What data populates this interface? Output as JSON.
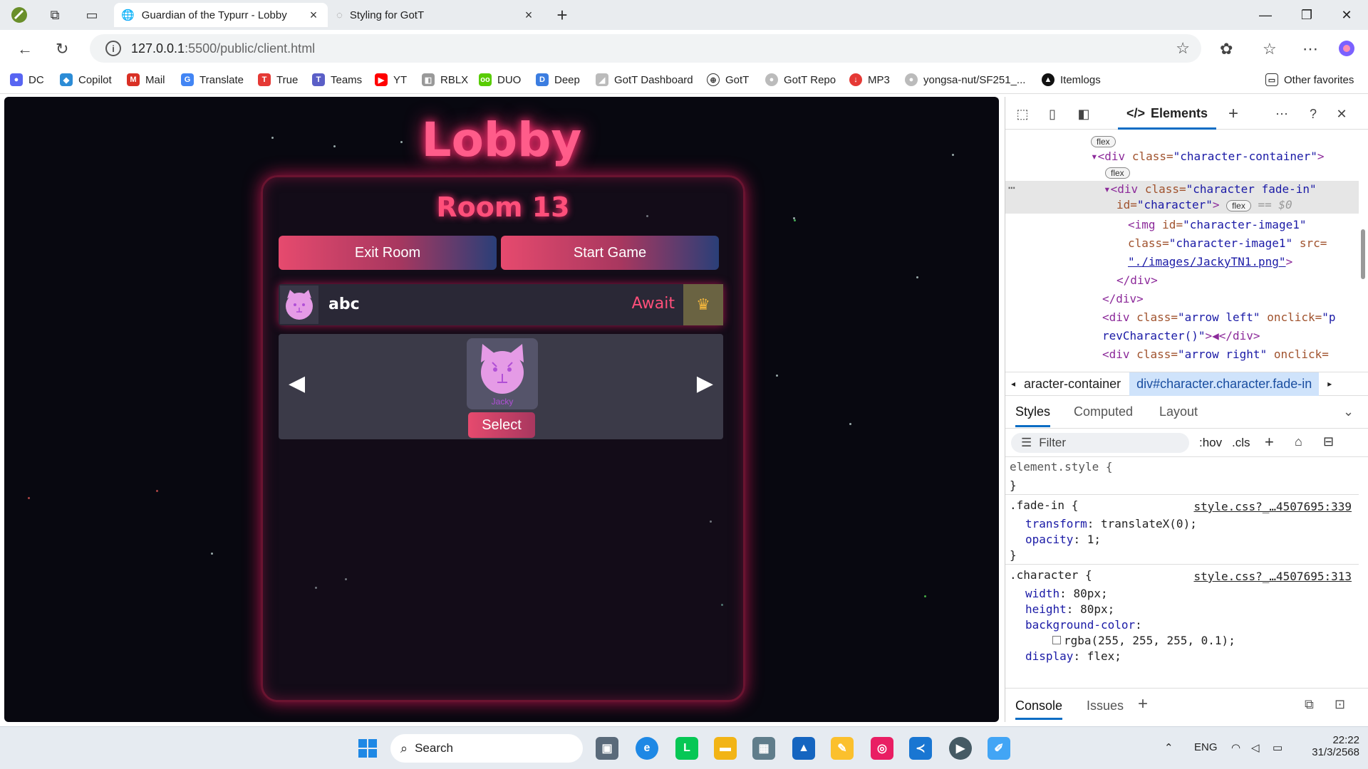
{
  "browser": {
    "tabs": [
      {
        "title": "Guardian of the Typurr - Lobby",
        "active": true
      },
      {
        "title": "Styling for GotT",
        "active": false
      }
    ],
    "url_host": "127.0.0.1",
    "url_path": ":5500/public/client.html",
    "bookmarks": [
      {
        "label": "DC",
        "color": "#5865f2"
      },
      {
        "label": "Copilot",
        "color": "#2c8cd6"
      },
      {
        "label": "Mail",
        "color": "#d93025"
      },
      {
        "label": "Translate",
        "color": "#4285f4"
      },
      {
        "label": "True",
        "color": "#e53935"
      },
      {
        "label": "Teams",
        "color": "#5b5fc7"
      },
      {
        "label": "YT",
        "color": "#ff0000"
      },
      {
        "label": "RBLX",
        "color": "#777777"
      },
      {
        "label": "DUO",
        "color": "#58cc02"
      },
      {
        "label": "Deep",
        "color": "#0f2b46"
      },
      {
        "label": "GotT Dashboard",
        "color": "#444444"
      },
      {
        "label": "GotT",
        "color": "#333333"
      },
      {
        "label": "GotT Repo",
        "color": "#222222"
      },
      {
        "label": "MP3",
        "color": "#e53935"
      },
      {
        "label": "yongsa-nut/SF251_...",
        "color": "#222222"
      },
      {
        "label": "Itemlogs",
        "color": "#111111"
      }
    ],
    "other_favorites": "Other favorites"
  },
  "game": {
    "title": "Lobby",
    "room_title": "Room 13",
    "exit_button": "Exit Room",
    "start_button": "Start Game",
    "player": {
      "name": "abc",
      "status": "Await"
    },
    "character_name": "Jacky",
    "select_button": "Select",
    "left_arrow": "◀",
    "right_arrow": "▶"
  },
  "devtools": {
    "elements_tab": "Elements",
    "tree": {
      "badge": "flex",
      "line1_tag": "<div ",
      "line1_attr": "class=",
      "line1_val": "\"character-container\"",
      "line1_end": ">",
      "line2_tag": "<div ",
      "line2_attr": "class=",
      "line2_val": "\"character fade-in\"",
      "line3_attr": "id=",
      "line3_val": "\"character\"",
      "line3_end": ">",
      "eq": "== $0",
      "line4_tag": "<img ",
      "line4_attr": "id=",
      "line4_val": "\"character-image1\"",
      "line5_attr": "class=",
      "line5_val": "\"character-image1\"",
      "line5_attr2": " src=",
      "line6_val": "\"./images/JackyTN1.png\"",
      "line6_end": ">",
      "close_div": "</div>",
      "line9_tag": "<div ",
      "line9_attr": "class=",
      "line9_val": "\"arrow left\"",
      "line9_attr2": " onclick=",
      "line9_val2": "\"p",
      "line10_val": "revCharacter()\"",
      "line10_rest": ">◀</div>",
      "line11_tag": "<div ",
      "line11_attr": "class=",
      "line11_val": "\"arrow right\"",
      "line11_attr2": " onclick="
    },
    "breadcrumb_1": "aracter-container",
    "breadcrumb_2": "div#character.character.fade-in",
    "pane_tabs": [
      "Styles",
      "Computed",
      "Layout"
    ],
    "filter_placeholder": "Filter",
    "filter_tools": [
      ":hov",
      ".cls"
    ],
    "styles": {
      "element_style": "element.style {",
      "close": "}",
      "rule1_sel": ".fade-in {",
      "rule1_src": "style.css?_…4507695:339",
      "rule1_p1": "transform",
      "rule1_v1": ": translateX(0);",
      "rule1_p2": "opacity",
      "rule1_v2": ": 1;",
      "rule2_sel": ".character {",
      "rule2_src": "style.css?_…4507695:313",
      "rule2_p1": "width",
      "rule2_v1": ": 80px;",
      "rule2_p2": "height",
      "rule2_v2": ": 80px;",
      "rule2_p3": "background-color",
      "rule2_v3": ":",
      "rule2_v3b": "rgba(255, 255, 255, 0.1);",
      "rule2_p4": "display",
      "rule2_v4": ": flex;"
    },
    "console_tabs": [
      "Console",
      "Issues"
    ]
  },
  "taskbar": {
    "search": "Search",
    "lang": "ENG",
    "time": "22:22",
    "date": "31/3/2568"
  }
}
